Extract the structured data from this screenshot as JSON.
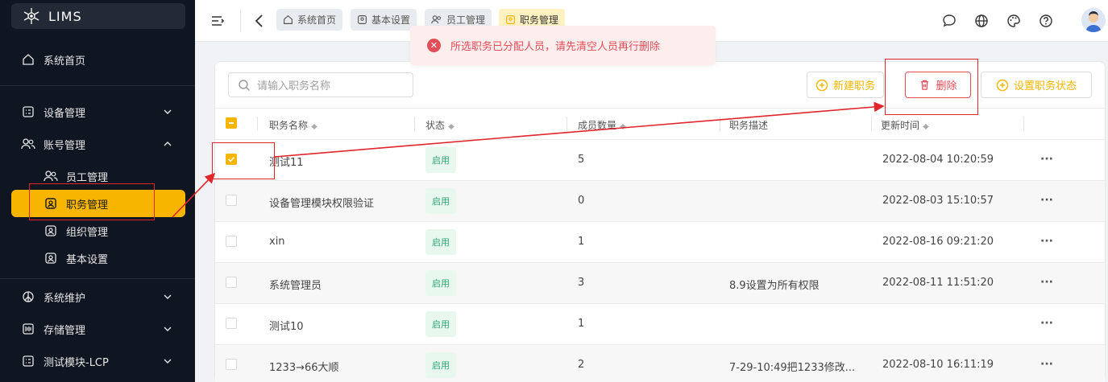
{
  "app": {
    "title": "LIMS"
  },
  "sidebar": {
    "home": "系统首页",
    "device": "设备管理",
    "account": "账号管理",
    "employee": "员工管理",
    "position": "职务管理",
    "org": "组织管理",
    "basic": "基本设置",
    "maintain": "系统维护",
    "storage": "存储管理",
    "test": "测试模块-LCP"
  },
  "tabs": [
    "系统首页",
    "基本设置",
    "员工管理",
    "职务管理"
  ],
  "toast": {
    "message": "所选职务已分配人员，请先清空人员再行删除"
  },
  "toolbar": {
    "search_placeholder": "请输入职务名称",
    "new": "新建职务",
    "delete": "删除",
    "set_status": "设置职务状态"
  },
  "table": {
    "headers": [
      "职务名称",
      "状态",
      "成员数量",
      "职务描述",
      "更新时间"
    ],
    "rows": [
      {
        "name": "测试11",
        "status": "启用",
        "count": "5",
        "desc": "",
        "time": "2022-08-04 10:20:59",
        "checked": true
      },
      {
        "name": "设备管理模块权限验证",
        "status": "启用",
        "count": "0",
        "desc": "",
        "time": "2022-08-03 15:10:57",
        "checked": false
      },
      {
        "name": "xin",
        "status": "启用",
        "count": "1",
        "desc": "",
        "time": "2022-08-16 09:21:20",
        "checked": false
      },
      {
        "name": "系统管理员",
        "status": "启用",
        "count": "3",
        "desc": "8.9设置为所有权限",
        "time": "2022-08-11 11:51:20",
        "checked": false
      },
      {
        "name": "测试10",
        "status": "启用",
        "count": "1",
        "desc": "",
        "time": "",
        "checked": false
      },
      {
        "name": "1233→66大顺",
        "status": "启用",
        "count": "2",
        "desc": "7-29-10:49把1233修改...",
        "time": "2022-08-10 16:11:19",
        "checked": false
      }
    ],
    "more": "···"
  },
  "colors": {
    "accent": "#f7b500",
    "danger": "#e34d59",
    "sidebar": "#0f1621",
    "success": "#2ba471"
  }
}
